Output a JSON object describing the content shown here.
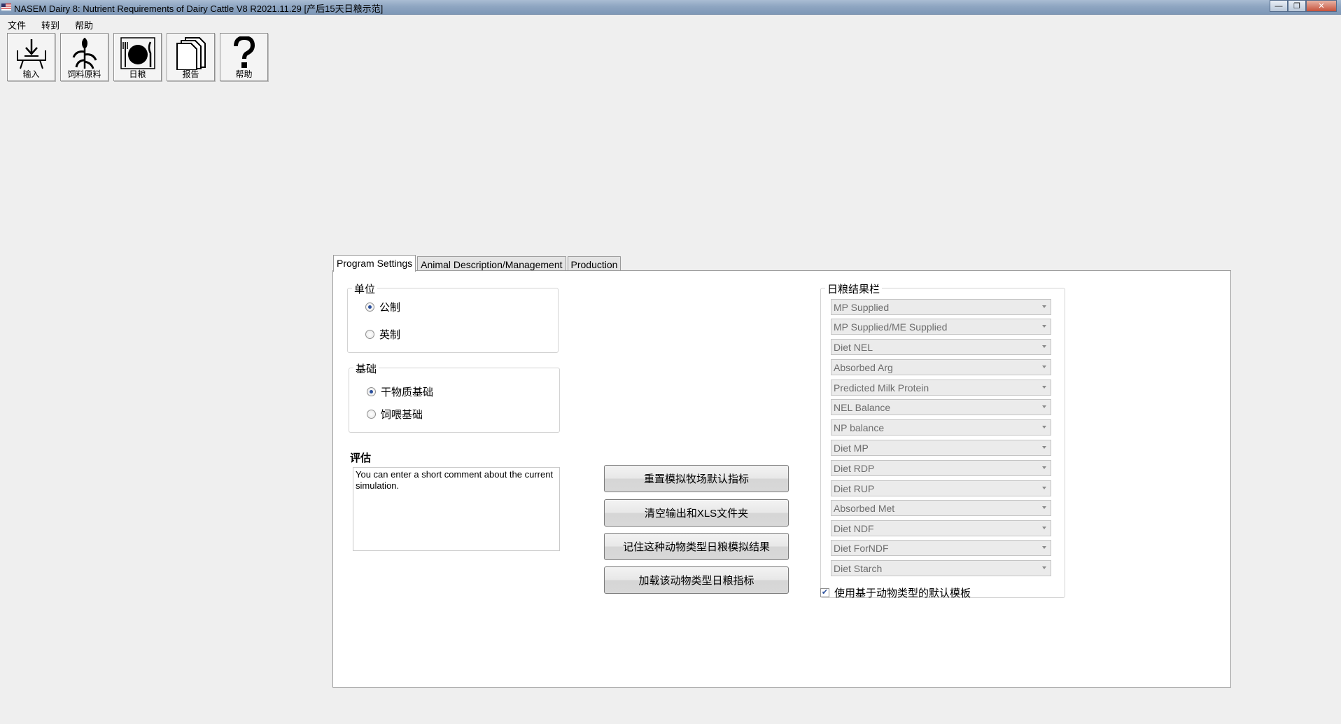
{
  "window": {
    "title": "NASEM Dairy 8: Nutrient Requirements of Dairy Cattle  V8 R2021.11.29 [产后15天日粮示范]",
    "minimize_icon": "minimize-icon",
    "restore_icon": "restore-icon",
    "close_icon": "close-icon"
  },
  "menu": [
    {
      "label": "文件"
    },
    {
      "label": "转到"
    },
    {
      "label": "帮助"
    }
  ],
  "toolbar": [
    {
      "label": "输入",
      "icon": "input-tray-icon"
    },
    {
      "label": "饲料原料",
      "icon": "corn-plant-icon"
    },
    {
      "label": "日粮",
      "icon": "plate-cutlery-icon"
    },
    {
      "label": "报告",
      "icon": "documents-icon"
    },
    {
      "label": "帮助",
      "icon": "question-mark-icon"
    }
  ],
  "tabs": [
    {
      "label": "Program Settings",
      "active": true
    },
    {
      "label": "Animal Description/Management",
      "active": false
    },
    {
      "label": "Production",
      "active": false
    }
  ],
  "settings": {
    "units": {
      "title": "单位",
      "options": [
        {
          "label": "公制",
          "selected": true
        },
        {
          "label": "英制",
          "selected": false
        }
      ]
    },
    "basis": {
      "title": "基础",
      "options": [
        {
          "label": "干物质基础",
          "selected": true
        },
        {
          "label": "饲喂基础",
          "selected": false
        }
      ]
    },
    "comment": {
      "label": "评估",
      "text": "You can enter a short comment about the current simulation."
    }
  },
  "actions": [
    {
      "label": "重置模拟牧场默认指标"
    },
    {
      "label": "清空输出和XLS文件夹"
    },
    {
      "label": "记住这种动物类型日粮模拟结果"
    },
    {
      "label": "加载该动物类型日粮指标"
    }
  ],
  "ration_results": {
    "title": "日粮结果栏",
    "items": [
      "MP Supplied",
      "MP Supplied/ME Supplied",
      "Diet NEL",
      "Absorbed Arg",
      "Predicted Milk Protein",
      "NEL Balance",
      "NP balance",
      "Diet MP",
      "Diet RDP",
      "Diet RUP",
      "Absorbed Met",
      "Diet NDF",
      "Diet ForNDF",
      "Diet Starch"
    ],
    "default_template": {
      "label": "使用基于动物类型的默认模板",
      "checked": true
    }
  }
}
